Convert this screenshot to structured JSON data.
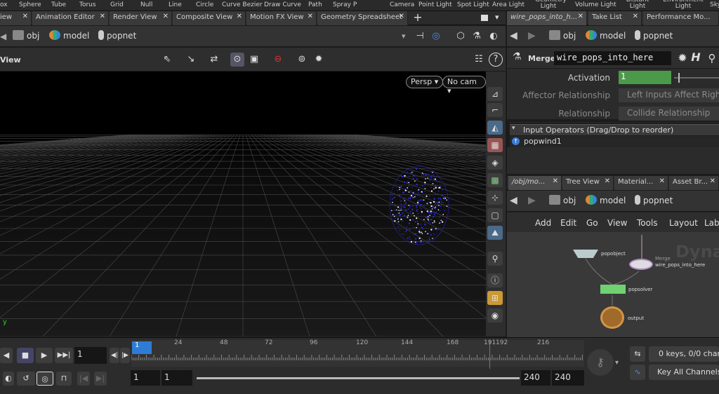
{
  "shelf": {
    "tools": [
      "ox",
      "Sphere",
      "Tube",
      "Torus",
      "Grid",
      "Null",
      "Line",
      "Circle",
      "Curve Bezier",
      "Draw Curve",
      "Path",
      "Spray P"
    ],
    "lights": [
      "Camera",
      "Point Light",
      "Spot Light",
      "Area Light",
      "Geometry Light",
      "Volume Light",
      "Distant Light",
      "Environment Light",
      "Sky"
    ]
  },
  "left_tabs": [
    "iew",
    "Animation Editor",
    "Render View",
    "Composite View",
    "Motion FX View",
    "Geometry Spreadsheet"
  ],
  "left_path": {
    "obj": "obj",
    "model": "model",
    "popnet": "popnet"
  },
  "viewport": {
    "title": "View",
    "persp": "Persp",
    "cam": "No cam",
    "axis_y": "y"
  },
  "right_tabs": [
    "wire_pops_into_h...",
    "Take List",
    "Performance Mo..."
  ],
  "right_path": {
    "obj": "obj",
    "model": "model",
    "popnet": "popnet"
  },
  "parm": {
    "node_type": "Merge",
    "node_name": "wire_pops_into_here",
    "help_label": "H",
    "activation_label": "Activation",
    "activation_value": "1",
    "activation_level": 1,
    "affector_label": "Affector Relationship",
    "affector_value": "Left Inputs Affect Right Inp",
    "relationship_label": "Relationship",
    "relationship_value": "Collide Relationship",
    "input_operators_header": "Input Operators (Drag/Drop to reorder)",
    "input_item": "popwind1"
  },
  "net_tabs": [
    "/obj/mo...",
    "Tree View",
    "Material...",
    "Asset Br..."
  ],
  "net_path": {
    "obj": "obj",
    "model": "model",
    "popnet": "popnet"
  },
  "net_menu": [
    "Add",
    "Edit",
    "Go",
    "View",
    "Tools",
    "Layout",
    "Lab"
  ],
  "network": {
    "watermark": "Dyna",
    "popobject": "popobject",
    "merge_type": "Merge",
    "merge_name": "wire_pops_into_here",
    "popsolver": "popsolver",
    "output": "output"
  },
  "timeline": {
    "current_frame": "1",
    "marker": "1",
    "ticks": [
      "24",
      "48",
      "72",
      "96",
      "120",
      "144",
      "168",
      "191",
      "192",
      "216"
    ],
    "start1": "1",
    "start2": "1",
    "end1": "240",
    "end2": "240",
    "keys_label": "0 keys, 0/0 chann",
    "key_all_label": "Key All Channels"
  },
  "colors": {
    "accent": "#2e7cd6",
    "activation": "#4a9a4a",
    "particles": "#2a2ad6",
    "node_green": "#6fd16f"
  }
}
